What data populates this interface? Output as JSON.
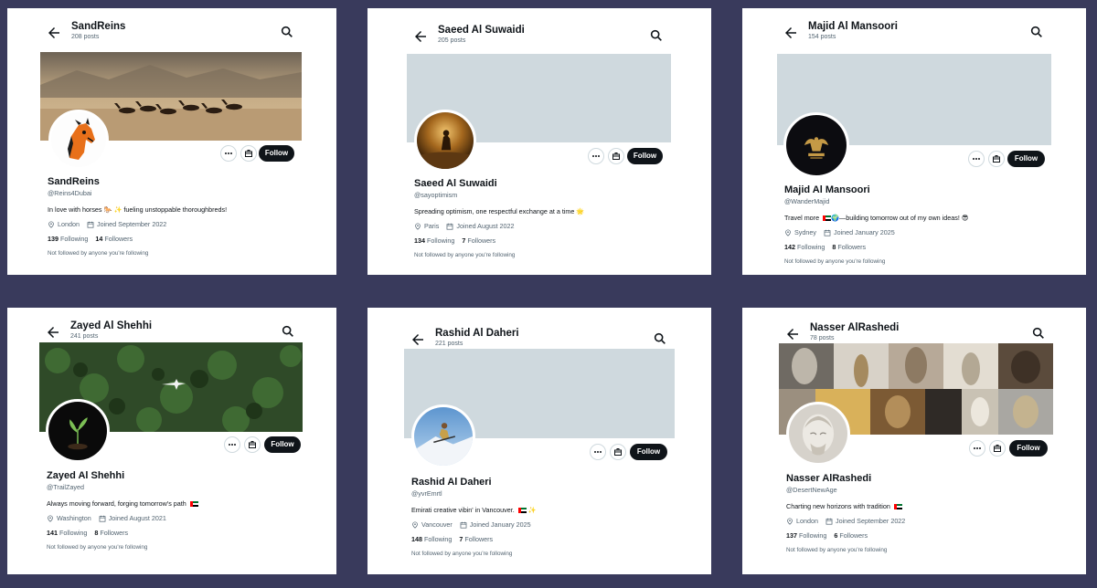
{
  "cards": [
    {
      "header_name": "SandReins",
      "header_posts": "208 posts",
      "display_name": "SandReins",
      "handle": "@Reins4Dubai",
      "bio": "In love with horses 🐎 ✨ fueling unstoppable thoroughbreds!",
      "location": "London",
      "joined": "Joined September 2022",
      "following_count": "139",
      "following_label": "Following",
      "followers_count": "14",
      "followers_label": "Followers",
      "not_followed": "Not followed by anyone you're following",
      "follow_label": "Follow",
      "banner": "desert horses",
      "avatar": "horse logo",
      "trailing_flag": false
    },
    {
      "header_name": "Saeed Al Suwaidi",
      "header_posts": "205 posts",
      "display_name": "Saeed Al Suwaidi",
      "handle": "@sayoptimism",
      "bio": "Spreading optimism, one respectful exchange at a time 🌟",
      "location": "Paris",
      "joined": "Joined August 2022",
      "following_count": "134",
      "following_label": "Following",
      "followers_count": "7",
      "followers_label": "Followers",
      "not_followed": "Not followed by anyone you're following",
      "follow_label": "Follow",
      "banner": "blank",
      "avatar": "desert wanderer",
      "trailing_flag": false
    },
    {
      "header_name": "Majid Al Mansoori",
      "header_posts": "154 posts",
      "display_name": "Majid Al Mansoori",
      "handle": "@WanderMajid",
      "bio_before": "Travel more ",
      "bio_after": "🌍—building tomorrow out of my own ideas! 😎",
      "location": "Sydney",
      "joined": "Joined January 2025",
      "following_count": "142",
      "following_label": "Following",
      "followers_count": "8",
      "followers_label": "Followers",
      "not_followed": "Not followed by anyone you're following",
      "follow_label": "Follow",
      "banner": "blank",
      "avatar": "falcon emblem",
      "trailing_flag": false
    },
    {
      "header_name": "Zayed Al Shehhi",
      "header_posts": "241 posts",
      "display_name": "Zayed Al Shehhi",
      "handle": "@TrailZayed",
      "bio": "Always moving forward, forging tomorrow's path",
      "location": "Washington",
      "joined": "Joined August 2021",
      "following_count": "141",
      "following_label": "Following",
      "followers_count": "8",
      "followers_label": "Followers",
      "not_followed": "Not followed by anyone you're following",
      "follow_label": "Follow",
      "banner": "forest plane",
      "avatar": "plant sprout",
      "trailing_flag": true
    },
    {
      "header_name": "Rashid Al Daheri",
      "header_posts": "221 posts",
      "display_name": "Rashid Al Daheri",
      "handle": "@yvrEmrtl",
      "bio_before": "Emirati creative vibin' in Vancouver. ",
      "bio_after": " ✨",
      "location": "Vancouver",
      "joined": "Joined January 2025",
      "following_count": "148",
      "following_label": "Following",
      "followers_count": "7",
      "followers_label": "Followers",
      "not_followed": "Not followed by anyone you're following",
      "follow_label": "Follow",
      "banner": "blank",
      "avatar": "skier",
      "trailing_flag": false
    },
    {
      "header_name": "Nasser AlRashedi",
      "header_posts": "78 posts",
      "display_name": "Nasser AlRashedi",
      "handle": "@DesertNewAge",
      "bio": "Charting new horizons with tradition",
      "location": "London",
      "joined": "Joined September 2022",
      "following_count": "137",
      "following_label": "Following",
      "followers_count": "6",
      "followers_label": "Followers",
      "not_followed": "Not followed by anyone you're following",
      "follow_label": "Follow",
      "banner": "sculpture collage",
      "avatar": "marble statue",
      "trailing_flag": true
    }
  ],
  "colors": {
    "background": "#393a5c",
    "card": "#ffffff",
    "follow_button": "#0f1419",
    "muted_text": "#536471",
    "blank_banner": "#cfd9de"
  },
  "icons": [
    "back-arrow-icon",
    "search-icon",
    "more-icon",
    "subscribe-icon",
    "location-icon",
    "calendar-icon"
  ]
}
